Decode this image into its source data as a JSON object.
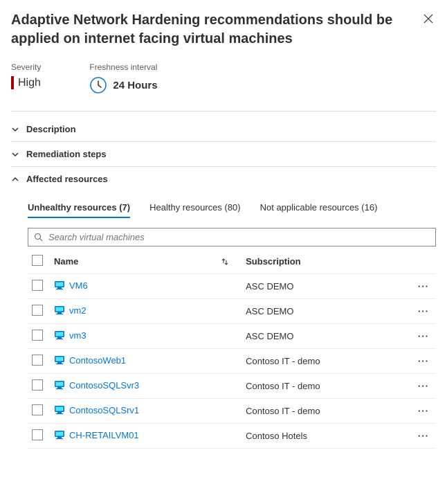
{
  "title": "Adaptive Network Hardening recommendations should be applied on internet facing virtual machines",
  "severity": {
    "label": "Severity",
    "value": "High",
    "color": "#a80000"
  },
  "freshness": {
    "label": "Freshness interval",
    "value": "24 Hours"
  },
  "sections": {
    "description": {
      "label": "Description",
      "expanded": false
    },
    "remediation": {
      "label": "Remediation steps",
      "expanded": false
    },
    "affected": {
      "label": "Affected resources",
      "expanded": true
    }
  },
  "tabs": {
    "unhealthy": {
      "label": "Unhealthy resources (7)",
      "count": 7,
      "active": true
    },
    "healthy": {
      "label": "Healthy resources (80)",
      "count": 80,
      "active": false
    },
    "na": {
      "label": "Not applicable resources (16)",
      "count": 16,
      "active": false
    }
  },
  "search": {
    "placeholder": "Search virtual machines"
  },
  "columns": {
    "name": "Name",
    "subscription": "Subscription"
  },
  "rows": [
    {
      "name": "VM6",
      "subscription": "ASC DEMO"
    },
    {
      "name": "vm2",
      "subscription": "ASC DEMO"
    },
    {
      "name": "vm3",
      "subscription": "ASC DEMO"
    },
    {
      "name": "ContosoWeb1",
      "subscription": "Contoso IT - demo"
    },
    {
      "name": "ContosoSQLSvr3",
      "subscription": "Contoso IT - demo"
    },
    {
      "name": "ContosoSQLSrv1",
      "subscription": "Contoso IT - demo"
    },
    {
      "name": "CH-RETAILVM01",
      "subscription": "Contoso Hotels"
    }
  ]
}
